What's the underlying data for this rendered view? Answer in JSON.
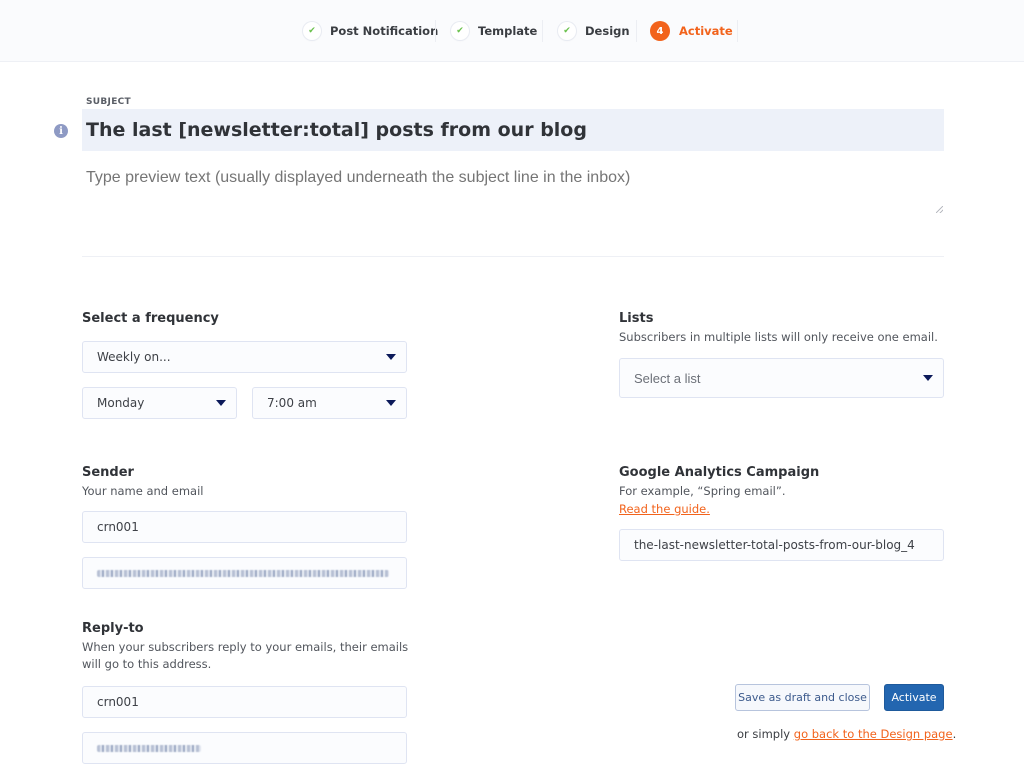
{
  "stepper": {
    "steps": [
      {
        "label": "Post Notification",
        "badge": "✔",
        "state": "done"
      },
      {
        "label": "Template",
        "badge": "✔",
        "state": "done"
      },
      {
        "label": "Design",
        "badge": "✔",
        "state": "done"
      },
      {
        "label": "Activate",
        "badge": "4",
        "state": "active"
      }
    ]
  },
  "subject": {
    "label": "SUBJECT",
    "value": "The last [newsletter:total] posts from our blog",
    "info_icon": "info-icon",
    "preview_placeholder": "Type preview text (usually displayed underneath the subject line in the inbox)"
  },
  "frequency": {
    "title": "Select a frequency",
    "interval": {
      "value": "Weekly on..."
    },
    "day": {
      "value": "Monday"
    },
    "time": {
      "value": "7:00 am"
    }
  },
  "lists": {
    "title": "Lists",
    "description": "Subscribers in multiple lists will only receive one email.",
    "select_placeholder": "Select a list"
  },
  "sender": {
    "title": "Sender",
    "description": "Your name and email",
    "name_value": "crn001",
    "email_value": "[redacted email]"
  },
  "analytics": {
    "title": "Google Analytics Campaign",
    "description": "For example, “Spring email”.",
    "guide_link": "Read the guide.",
    "campaign_value": "the-last-newsletter-total-posts-from-our-blog_4"
  },
  "reply_to": {
    "title": "Reply-to",
    "description": "When your subscribers reply to your emails, their emails will go to this address.",
    "name_value": "crn001",
    "email_value": "[redacted email]"
  },
  "actions": {
    "save_draft_label": "Save as draft and close",
    "activate_label": "Activate",
    "footer_prefix": "or simply ",
    "footer_link": "go back to the Design page",
    "footer_suffix": "."
  },
  "colors": {
    "accent_orange": "#f2631c",
    "primary_blue": "#2366b0",
    "done_check": "#68c04b",
    "select_caret": "#0c1a5a"
  }
}
